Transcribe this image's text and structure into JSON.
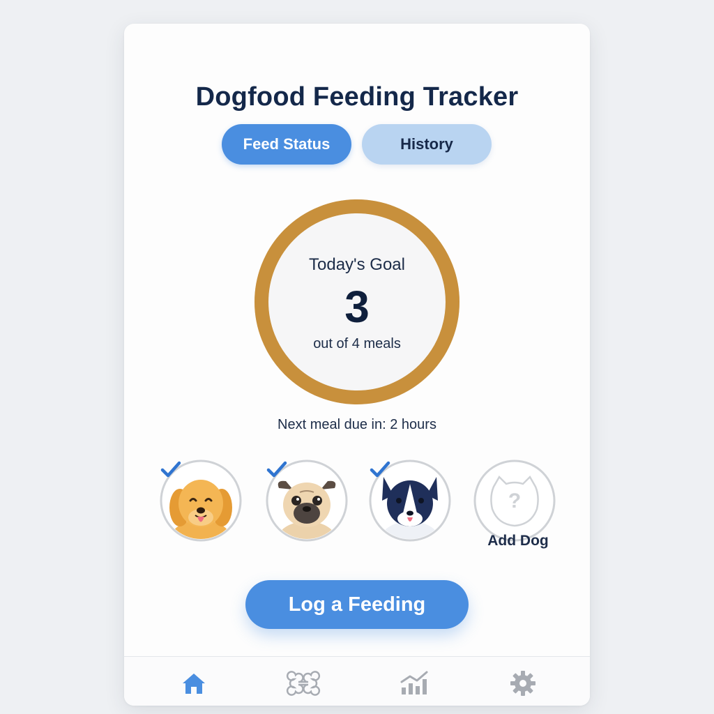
{
  "app": {
    "title": "Dogfood Feeding Tracker"
  },
  "tabs": [
    {
      "label": "Feed Status",
      "active": true
    },
    {
      "label": "History",
      "active": false
    }
  ],
  "goal": {
    "label": "Today's Goal",
    "value": "3",
    "subtext": "out of 4 meals",
    "progress_fraction": 1.0
  },
  "next_meal": {
    "text": "Next meal due in: 2 hours"
  },
  "dogs": [
    {
      "icon": "golden-retriever-avatar",
      "fed": true
    },
    {
      "icon": "pug-avatar",
      "fed": true
    },
    {
      "icon": "border-collie-avatar",
      "fed": true
    },
    {
      "icon": "add-dog-placeholder",
      "label": "Add Dog"
    }
  ],
  "actions": {
    "log_feeding_label": "Log a Feeding"
  },
  "bottom_nav": [
    {
      "icon": "home-icon",
      "active": true
    },
    {
      "icon": "bone-icon",
      "active": false
    },
    {
      "icon": "chart-icon",
      "active": false
    },
    {
      "icon": "gear-icon",
      "active": false
    }
  ],
  "colors": {
    "accent": "#4a8ee0",
    "accent_light": "#b9d4f1",
    "ring": "#c8903c",
    "text_dark": "#14284a",
    "check": "#2f74d0",
    "nav_inactive": "#a7abb2"
  }
}
